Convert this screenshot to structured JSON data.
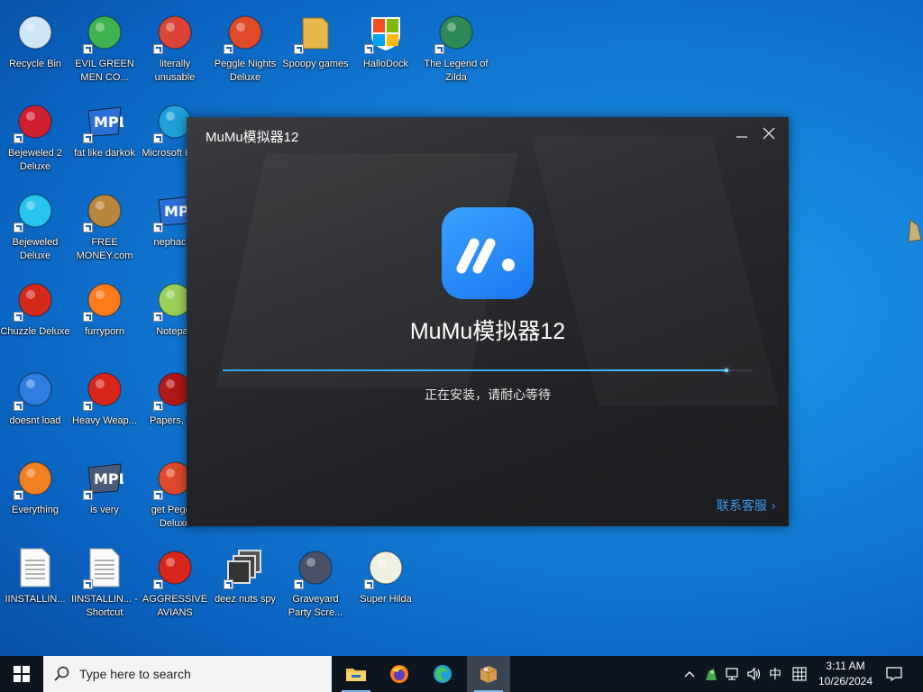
{
  "desktop": {
    "icons": [
      {
        "label": "Recycle Bin",
        "icon": "recycle-bin-icon",
        "color": "#cfe6f8"
      },
      {
        "label": "EVIL GREEN MEN CO...",
        "icon": "green-men-icon",
        "color": "#3fb34f"
      },
      {
        "label": "literally unusable",
        "icon": "chrome-icon",
        "color": "#db4437"
      },
      {
        "label": "Peggle Nights Deluxe",
        "icon": "peggle-icon",
        "color": "#e04a2a"
      },
      {
        "label": "Spoopy games",
        "icon": "folder-icon",
        "color": "#e8b84a"
      },
      {
        "label": "HalloDock",
        "icon": "windows-logo-icon",
        "color": "#f25022"
      },
      {
        "label": "The Legend of Zilda",
        "icon": "game-character-icon",
        "color": "#2e8b57"
      },
      {
        "label": "Bejeweled 2 Deluxe",
        "icon": "bejeweled2-icon",
        "color": "#d02030"
      },
      {
        "label": "fat like darkok",
        "icon": "mpl-icon",
        "color": "#2a6fd6"
      },
      {
        "label": "Microsoft Edge",
        "icon": "edge-icon",
        "color": "#1fa0d8"
      },
      {
        "label": "Bejeweled Deluxe",
        "icon": "gem-icon",
        "color": "#27c4f0"
      },
      {
        "label": "FREE MONEY.com",
        "icon": "money-bag-icon",
        "color": "#b8863c"
      },
      {
        "label": "nephacks",
        "icon": "mpl-icon",
        "color": "#2a6fd6"
      },
      {
        "label": "Chuzzle Deluxe",
        "icon": "chuzzle-icon",
        "color": "#d42a1c"
      },
      {
        "label": "furryporn",
        "icon": "firefox-icon",
        "color": "#ff7a1a"
      },
      {
        "label": "Notepad",
        "icon": "notepad-icon",
        "color": "#9ccf5a"
      },
      {
        "label": "doesnt load",
        "icon": "thunderbird-icon",
        "color": "#2f7de0"
      },
      {
        "label": "Heavy Weap...",
        "icon": "radiation-icon",
        "color": "#d8261a"
      },
      {
        "label": "Papers, P...",
        "icon": "papers-icon",
        "color": "#b31818"
      },
      {
        "label": "Everything",
        "icon": "search-magnifier-icon",
        "color": "#f08020"
      },
      {
        "label": "is very",
        "icon": "mpl-shield-icon",
        "color": "#4a5a78"
      },
      {
        "label": "get Peggle Deluxe",
        "icon": "peggle-icon",
        "color": "#e04a2a"
      },
      {
        "label": "IINSTALLIN...",
        "icon": "text-file-icon",
        "color": "#f4f4f4"
      },
      {
        "label": "IINSTALLIN... - Shortcut",
        "icon": "text-file-icon",
        "color": "#f4f4f4"
      },
      {
        "label": "AGGRESSIVE AVIANS",
        "icon": "angry-bird-icon",
        "color": "#d8261a"
      },
      {
        "label": "deez nuts spy",
        "icon": "stacked-windows-icon",
        "color": "#707070"
      },
      {
        "label": "Graveyard Party Scre...",
        "icon": "graveyard-icon",
        "color": "#4a5068"
      },
      {
        "label": "Super Hilda",
        "icon": "super-hilda-icon",
        "color": "#f0f0e0"
      }
    ]
  },
  "installer": {
    "title": "MuMu模拟器12",
    "app_name": "MuMu模拟器12",
    "status": "正在安装，请耐心等待",
    "progress": 0.95,
    "support_link": "联系客服 ›",
    "accent": "#3a9bf0"
  },
  "taskbar": {
    "search_placeholder": "Type here to search",
    "apps": [
      "file-explorer-icon",
      "firefox-icon",
      "edge-icon",
      "installer-package-icon"
    ],
    "ime": "中",
    "time": "3:11 AM",
    "date": "10/26/2024"
  }
}
